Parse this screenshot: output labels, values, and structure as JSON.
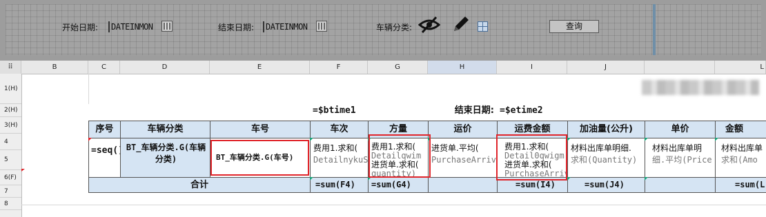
{
  "parameters": {
    "start_date_label": "开始日期:",
    "start_date_value": "DATEINMON",
    "end_date_label": "结束日期:",
    "end_date_value": "DATEINMON",
    "vehicle_category_label": "车辆分类:",
    "query_button": "查询"
  },
  "columns": [
    "B",
    "C",
    "D",
    "E",
    "F",
    "G",
    "H",
    "I",
    "J"
  ],
  "last_col_partial": "L",
  "rows": [
    "1(H)",
    "2(H)",
    "3(H)",
    "4",
    "5",
    "6(F)",
    "7",
    "8"
  ],
  "title_row": {
    "start_time_formula": "=$btime1",
    "end_date_label": "结束日期:",
    "end_time_formula": "=$etime2"
  },
  "headers": [
    "序号",
    "车辆分类",
    "车号",
    "车次",
    "方量",
    "运价",
    "运费金额",
    "加油量(公升)",
    "单价",
    "金额"
  ],
  "data_row": {
    "seq": "=seq()",
    "vehicle_category": "BT_车辆分类.G(车辆分类)",
    "vehicle_no": "BT_车辆分类.G(车号)",
    "trips_line1": "费用1.求和(",
    "trips_line2": "DetailnykuS",
    "volume_line1": "费用1.求和(",
    "volume_line2": "Detailqwim",
    "volume_line3": "进货单.求和(",
    "volume_line4": "quantity)",
    "price_line1": "进货单.平均(",
    "price_line2": "PurchaseArrivi",
    "amount_line1": "费用1.求和(",
    "amount_line2": "Detail0qwigm",
    "amount_line3": "进货单.求和(",
    "amount_line4": "PurchaseArrivi",
    "fuel_line1": "材料出库单明细.",
    "fuel_line2": "求和(Quantity)",
    "unit_price_line1": "材料出库单明",
    "unit_price_line2": "细.平均(Price",
    "money_line1": "材料出库单",
    "money_line2": "求和(Amo"
  },
  "total_row": {
    "label": "合计",
    "f": "=sum(F4)",
    "g": "=sum(G4)",
    "i": "=sum(I4)",
    "j": "=sum(J4)",
    "l": "=sum(L"
  },
  "colors": {
    "header_fill": "#d5e4f3",
    "highlight": "#e0242a"
  }
}
